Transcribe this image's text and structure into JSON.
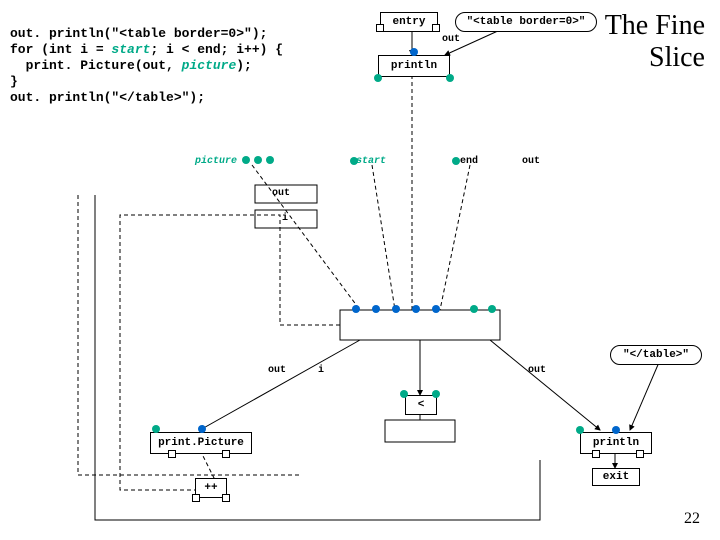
{
  "title_l1": "The Fine",
  "title_l2": "Slice",
  "slide_number": "22",
  "code_line1": "out. println(\"<table border=0>\");",
  "code_line2a": "for (int i = ",
  "code_line2b": "start",
  "code_line2c": "; i < end; i++) {",
  "code_line3a": "  print. Picture(out, ",
  "code_line3b": "picture",
  "code_line3c": ");",
  "code_line4": "}",
  "code_line5": "out. println(\"</table>\");",
  "nodes": {
    "entry": "entry",
    "tb0": "\"<table border=0>\"",
    "out_port": "out",
    "println1": "println",
    "picture": "picture",
    "start": "start",
    "end": "end",
    "out_lbl1": "out",
    "out_lbl2": "out",
    "out_lbl3": "out",
    "out_lbl4": "out",
    "i_lbl": "i",
    "i_lbl2": "i",
    "lt": "<",
    "printPicture": "print.Picture",
    "inc": "++",
    "tbclose": "\"</table>\"",
    "println2": "println",
    "exit": "exit"
  }
}
